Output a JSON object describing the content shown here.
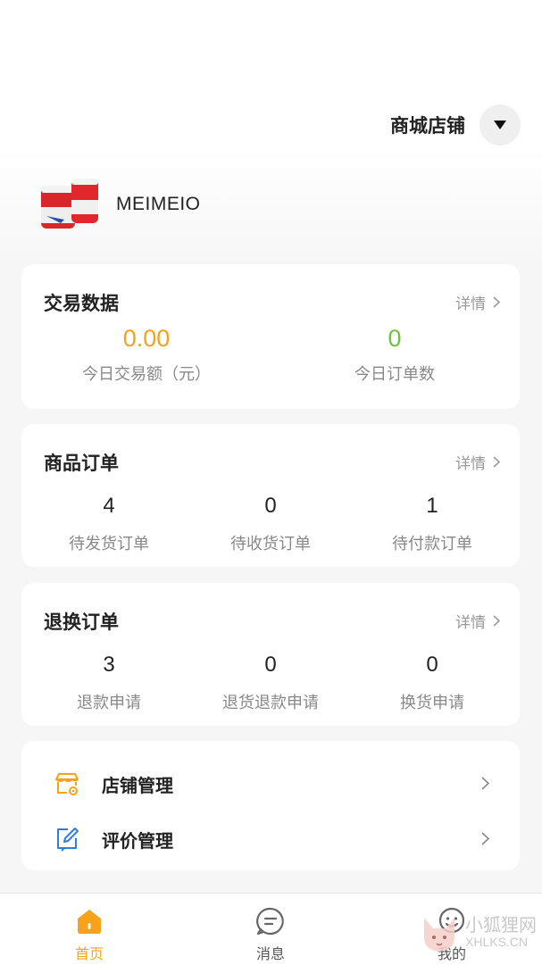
{
  "header": {
    "shop_selector_label": "商城店铺"
  },
  "profile": {
    "store_name": "MEIMEIO"
  },
  "transaction": {
    "title": "交易数据",
    "detail_label": "详情",
    "stats": [
      {
        "value": "0.00",
        "label": "今日交易额（元）"
      },
      {
        "value": "0",
        "label": "今日订单数"
      }
    ]
  },
  "product_orders": {
    "title": "商品订单",
    "detail_label": "详情",
    "stats": [
      {
        "value": "4",
        "label": "待发货订单"
      },
      {
        "value": "0",
        "label": "待收货订单"
      },
      {
        "value": "1",
        "label": "待付款订单"
      }
    ]
  },
  "return_orders": {
    "title": "退换订单",
    "detail_label": "详情",
    "stats": [
      {
        "value": "3",
        "label": "退款申请"
      },
      {
        "value": "0",
        "label": "退货退款申请"
      },
      {
        "value": "0",
        "label": "换货申请"
      }
    ]
  },
  "menu": [
    {
      "label": "店铺管理",
      "icon": "store-settings-icon"
    },
    {
      "label": "评价管理",
      "icon": "edit-review-icon"
    }
  ],
  "tabbar": [
    {
      "label": "首页",
      "icon": "home-icon",
      "active": true
    },
    {
      "label": "消息",
      "icon": "message-icon",
      "active": false
    },
    {
      "label": "我的",
      "icon": "profile-icon",
      "active": false
    }
  ],
  "watermark": {
    "cn": "小狐狸网",
    "en": "XHLKS.CN"
  },
  "colors": {
    "accent": "#f7a21b",
    "green": "#6bc43a",
    "blue": "#2f7de1",
    "background": "#f6f6f6"
  }
}
